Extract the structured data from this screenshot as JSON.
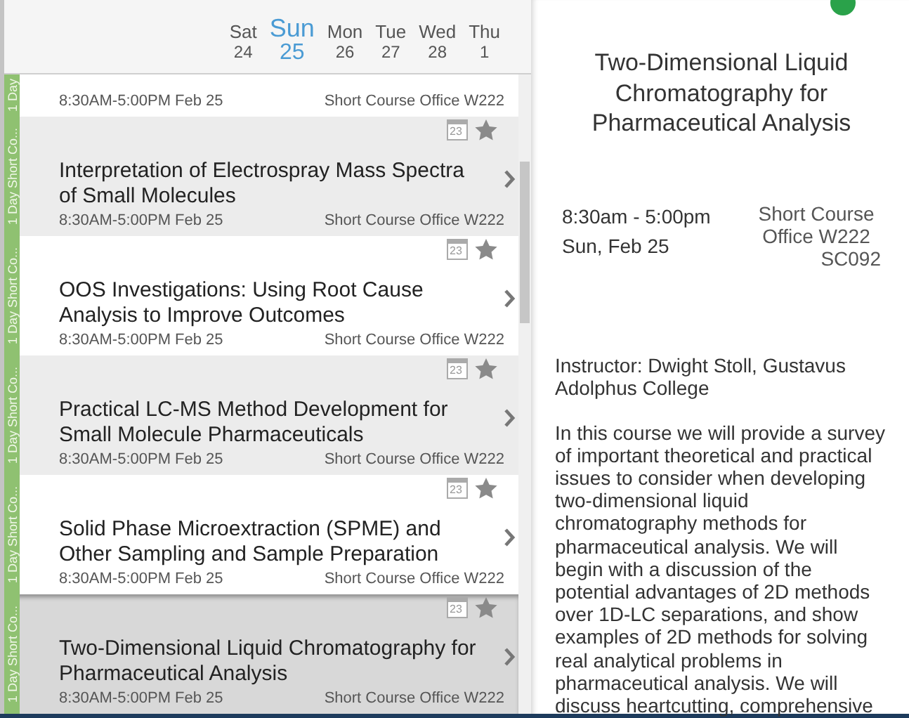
{
  "days": [
    {
      "dow": "Sat",
      "date": "24",
      "selected": false
    },
    {
      "dow": "Sun",
      "date": "25",
      "selected": true
    },
    {
      "dow": "Mon",
      "date": "26",
      "selected": false
    },
    {
      "dow": "Tue",
      "date": "27",
      "selected": false
    },
    {
      "dow": "Wed",
      "date": "28",
      "selected": false
    },
    {
      "dow": "Thu",
      "date": "1",
      "selected": false
    }
  ],
  "sessions": [
    {
      "track": "1 Day",
      "cut_off": true,
      "time": "8:30AM-5:00PM Feb 25",
      "location": "Short Course Office W222",
      "selected": false
    },
    {
      "track": "1 Day Short Co...",
      "cut_off": false,
      "calendar_day": "23",
      "title": "Interpretation of Electrospray Mass Spectra of Small Molecules",
      "time": "8:30AM-5:00PM Feb 25",
      "location": "Short Course Office W222",
      "selected": false
    },
    {
      "track": "1 Day Short Co...",
      "cut_off": false,
      "calendar_day": "23",
      "title": "OOS Investigations: Using Root Cause Analysis to Improve Outcomes",
      "time": "8:30AM-5:00PM Feb 25",
      "location": "Short Course Office W222",
      "selected": false
    },
    {
      "track": "1 Day Short Co...",
      "cut_off": false,
      "calendar_day": "23",
      "title": "Practical LC-MS Method Development for Small Molecule Pharmaceuticals",
      "time": "8:30AM-5:00PM Feb 25",
      "location": "Short Course Office W222",
      "selected": false
    },
    {
      "track": "1 Day Short Co...",
      "cut_off": false,
      "calendar_day": "23",
      "title": "Solid Phase Microextraction (SPME) and Other Sampling and Sample Preparation",
      "time": "8:30AM-5:00PM Feb 25",
      "location": "Short Course Office W222",
      "selected": false
    },
    {
      "track": "1 Day Short Co...",
      "cut_off": false,
      "calendar_day": "23",
      "title": "Two-Dimensional Liquid Chromatography for Pharmaceutical Analysis",
      "time": "8:30AM-5:00PM Feb 25",
      "location": "Short Course Office W222",
      "selected": true
    }
  ],
  "detail": {
    "title": "Two-Dimensional Liquid Chromatography for Pharmaceutical Analysis",
    "time": "8:30am - 5:00pm",
    "date": "Sun, Feb 25",
    "location": "Short Course Office W222",
    "code": "SC092",
    "instructor": "Instructor: Dwight Stoll, Gustavus Adolphus College",
    "description": "In this course we will provide a survey of important theoretical and practical issues to consider when developing two-dimensional liquid chromatography methods for pharmaceutical analysis. We will begin with a discussion of the potential advantages of 2D methods over 1D-LC separations, and show examples of 2D methods for solving real analytical problems in pharmaceutical analysis. We will discuss heartcutting, comprehensive"
  }
}
